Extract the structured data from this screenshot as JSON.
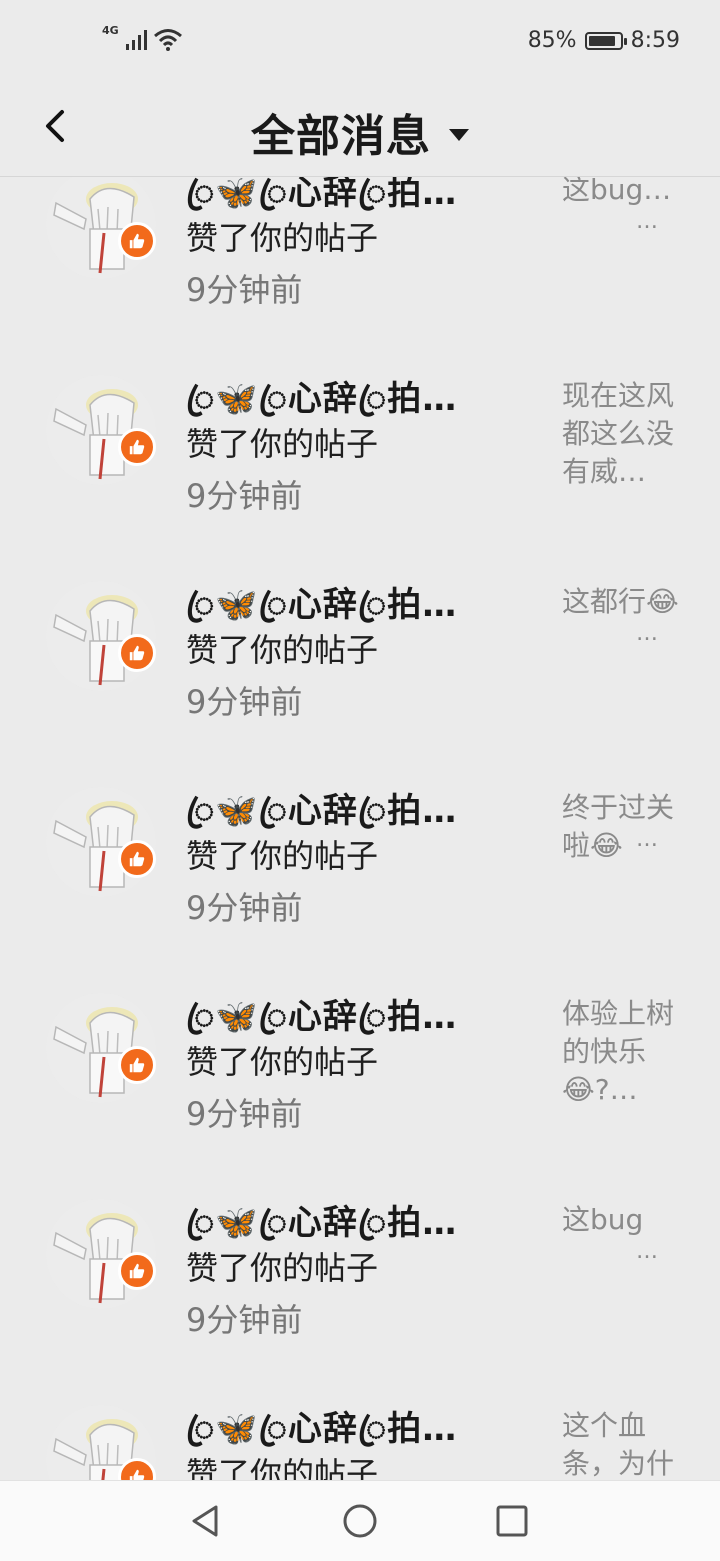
{
  "status_bar": {
    "network": "4G",
    "battery_percent": "85%",
    "battery_level": 0.85,
    "time": "8:59",
    "icons": [
      "signal-icon",
      "wifi-icon",
      "battery-icon"
    ]
  },
  "header": {
    "back_icon": "chevron-left-icon",
    "title": "全部消息",
    "dropdown_icon": "caret-down-icon"
  },
  "colors": {
    "background": "#ebebeb",
    "like_badge": "#f26a1b",
    "secondary_text": "#777777",
    "snippet_text": "#8a8a8a"
  },
  "items": [
    {
      "name": "ꦿ🦋ꦿ心辞ꦿ拍…",
      "action": "赞了你的帖子",
      "time": "9分钟前",
      "snippet": "这bug…",
      "more": "…"
    },
    {
      "name": "ꦿ🦋ꦿ心辞ꦿ拍…",
      "action": "赞了你的帖子",
      "time": "9分钟前",
      "snippet": "现在这风都这么没有威…",
      "more": ""
    },
    {
      "name": "ꦿ🦋ꦿ心辞ꦿ拍…",
      "action": "赞了你的帖子",
      "time": "9分钟前",
      "snippet": "这都行😂",
      "more": "…"
    },
    {
      "name": "ꦿ🦋ꦿ心辞ꦿ拍…",
      "action": "赞了你的帖子",
      "time": "9分钟前",
      "snippet": "终于过关啦😂",
      "more": "…"
    },
    {
      "name": "ꦿ🦋ꦿ心辞ꦿ拍…",
      "action": "赞了你的帖子",
      "time": "9分钟前",
      "snippet": "体验上树的快乐😂?…",
      "more": ""
    },
    {
      "name": "ꦿ🦋ꦿ心辞ꦿ拍…",
      "action": "赞了你的帖子",
      "time": "9分钟前",
      "snippet": "这bug",
      "more": "…"
    },
    {
      "name": "ꦿ🦋ꦿ心辞ꦿ拍…",
      "action": "赞了你的帖子",
      "time": "",
      "snippet": "这个血条，为什么打到",
      "more": ""
    }
  ],
  "nav": {
    "back_icon": "triangle-back-icon",
    "home_icon": "circle-home-icon",
    "recents_icon": "square-recents-icon"
  }
}
